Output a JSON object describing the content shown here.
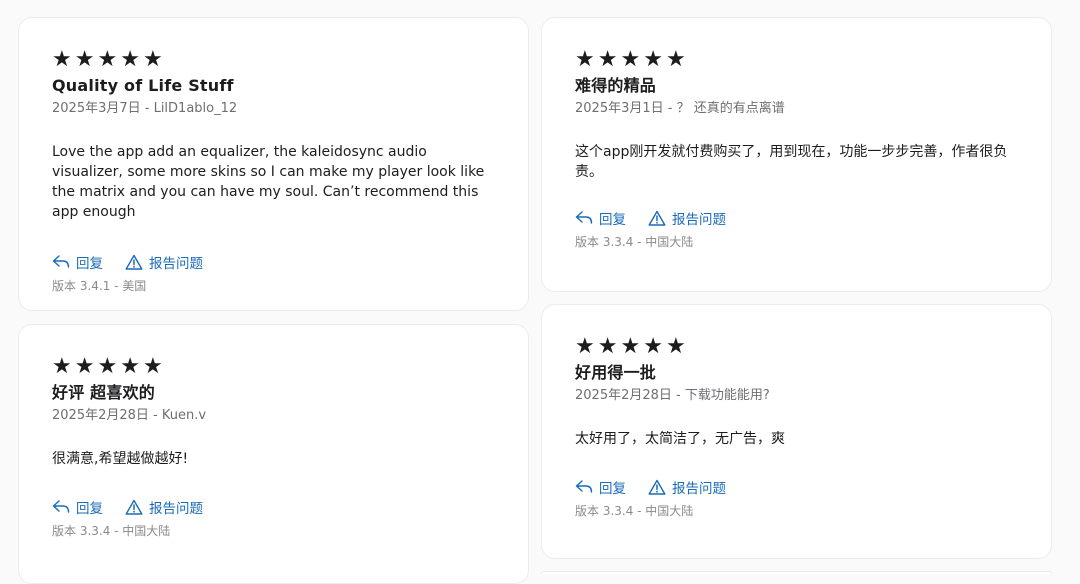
{
  "reviews": [
    {
      "stars": [
        "★",
        "★",
        "★",
        "★",
        "★"
      ],
      "title": "Quality of Life Stuff",
      "meta": "2025年3月7日 - LilD1ablo_12",
      "body": "Love the app add an equalizer, the kaleidosync audio visualizer, some more skins so I can make my player look like the matrix and you can have my soul. Can’t recommend this app enough",
      "reply_label": "回复",
      "report_label": "报告问题",
      "version": "版本 3.4.1 - 美国"
    },
    {
      "stars": [
        "★",
        "★",
        "★",
        "★",
        "★"
      ],
      "title": "难得的精品",
      "meta": "2025年3月1日 - ？ 还真的有点离谱",
      "body": "这个app刚开发就付费购买了，用到现在，功能一步步完善，作者很负责。",
      "reply_label": "回复",
      "report_label": "报告问题",
      "version": "版本 3.3.4 - 中国大陆"
    },
    {
      "stars": [
        "★",
        "★",
        "★",
        "★",
        "★"
      ],
      "title": "好评 超喜欢的",
      "meta": "2025年2月28日 - Kuen.v",
      "body": "很满意,希望越做越好!",
      "reply_label": "回复",
      "report_label": "报告问题",
      "version": "版本 3.3.4 - 中国大陆"
    },
    {
      "stars": [
        "★",
        "★",
        "★",
        "★",
        "★"
      ],
      "title": "好用得一批",
      "meta": "2025年2月28日 - 下载功能能用?",
      "body": "太好用了，太简洁了，无广告，爽",
      "reply_label": "回复",
      "report_label": "报告问题",
      "version": "版本 3.3.4 - 中国大陆"
    }
  ],
  "colors": {
    "accent": "#1a6bb8",
    "text": "#1d1d1f",
    "muted": "#6e6e73",
    "card_bg": "#ffffff",
    "page_bg": "#fafafa"
  },
  "icons": {
    "reply": "reply-arrow-icon",
    "report": "warning-triangle-icon",
    "star": "star-icon"
  }
}
